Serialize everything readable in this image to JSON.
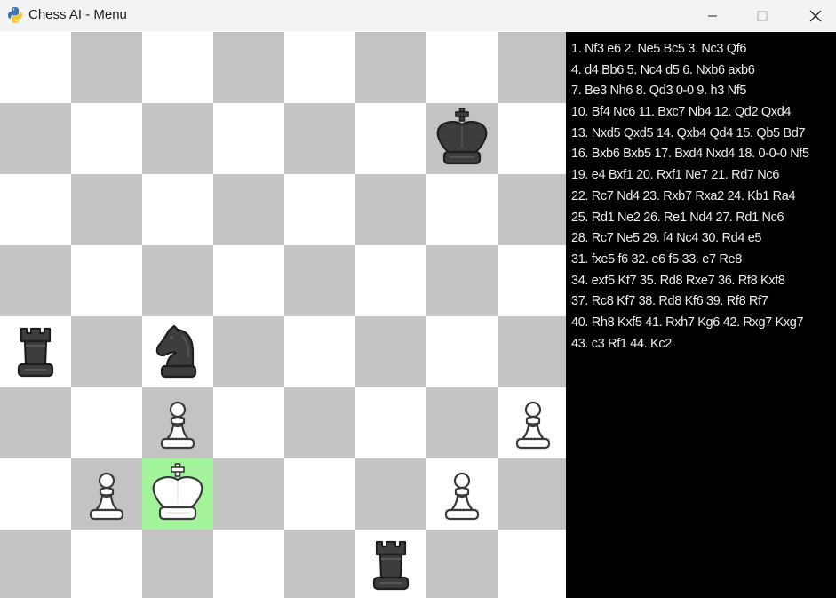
{
  "window": {
    "title": "Chess AI - Menu",
    "app_icon": "python-snake-icon",
    "controls": [
      "minimize-icon",
      "maximize-icon",
      "close-icon"
    ]
  },
  "board": {
    "light_color": "#ffffff",
    "dark_color": "#c3c3c3",
    "highlight_color": "#a3f39a",
    "highlighted_square": "c2",
    "pieces": [
      {
        "square": "g7",
        "type": "king",
        "color": "black"
      },
      {
        "square": "a4",
        "type": "rook",
        "color": "black"
      },
      {
        "square": "c4",
        "type": "knight",
        "color": "black"
      },
      {
        "square": "c3",
        "type": "pawn",
        "color": "white"
      },
      {
        "square": "h3",
        "type": "pawn",
        "color": "white"
      },
      {
        "square": "b2",
        "type": "pawn",
        "color": "white"
      },
      {
        "square": "c2",
        "type": "king",
        "color": "white"
      },
      {
        "square": "g2",
        "type": "pawn",
        "color": "white"
      },
      {
        "square": "f1",
        "type": "rook",
        "color": "black"
      }
    ]
  },
  "move_list": [
    "1. Nf3 e6  2. Ne5 Bc5  3. Nc3 Qf6",
    "4. d4 Bb6  5. Nc4 d5  6. Nxb6 axb6",
    "7. Be3 Nh6  8. Qd3 0-0  9. h3 Nf5",
    "10. Bf4 Nc6  11. Bxc7 Nb4  12. Qd2 Qxd4",
    "13. Nxd5 Qxd5  14. Qxb4 Qd4  15. Qb5 Bd7",
    "16. Bxb6 Bxb5  17. Bxd4 Nxd4  18. 0-0-0 Nf5",
    "19. e4 Bxf1  20. Rxf1 Ne7  21. Rd7 Nc6",
    "22. Rc7 Nd4  23. Rxb7 Rxa2  24. Kb1 Ra4",
    "25. Rd1 Ne2  26. Re1 Nd4  27. Rd1 Nc6",
    "28. Rc7 Ne5  29. f4 Nc4  30. Rd4 e5",
    "31. fxe5 f6  32. e6 f5  33. e7 Re8",
    "34. exf5 Kf7  35. Rd8 Rxe7  36. Rf8 Kxf8",
    "37. Rc8 Kf7  38. Rd8 Kf6  39. Rf8 Rf7",
    "40. Rh8 Kxf5  41. Rxh7 Kg6  42. Rxg7 Kxg7",
    "43. c3 Rf1  44. Kc2"
  ]
}
